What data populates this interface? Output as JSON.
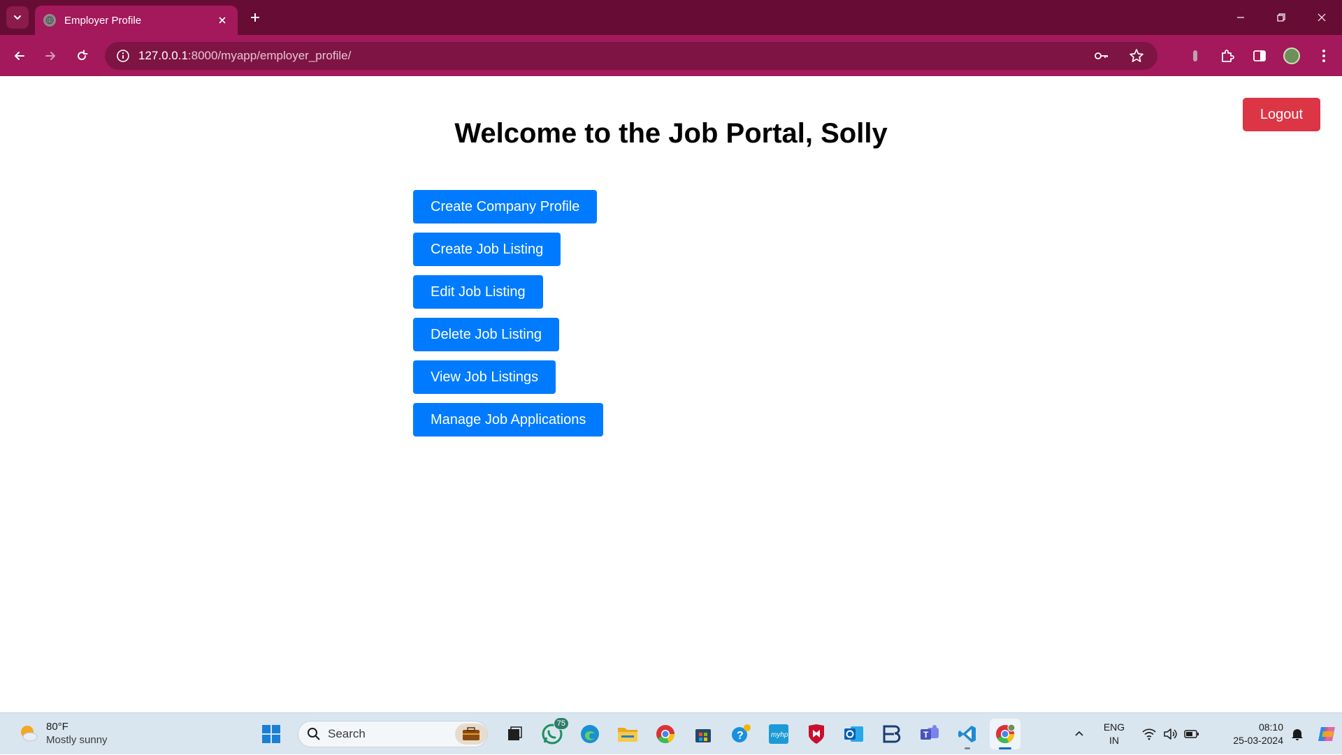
{
  "browser": {
    "tab_title": "Employer Profile",
    "url_host": "127.0.0.1",
    "url_path": ":8000/myapp/employer_profile/"
  },
  "page": {
    "title": "Welcome to the Job Portal, Solly",
    "logout_label": "Logout",
    "actions": [
      {
        "label": "Create Company Profile"
      },
      {
        "label": "Create Job Listing"
      },
      {
        "label": "Edit Job Listing"
      },
      {
        "label": "Delete Job Listing"
      },
      {
        "label": "View Job Listings"
      },
      {
        "label": "Manage Job Applications"
      }
    ]
  },
  "taskbar": {
    "weather_temp": "80°F",
    "weather_desc": "Mostly sunny",
    "search_label": "Search",
    "whatsapp_badge": "75",
    "lang_line1": "ENG",
    "lang_line2": "IN",
    "time": "08:10",
    "date": "25-03-2024"
  },
  "colors": {
    "tabstrip": "#670d35",
    "toolbar": "#a3195b",
    "primary_button": "#007bff",
    "logout_button": "#dc3545"
  }
}
